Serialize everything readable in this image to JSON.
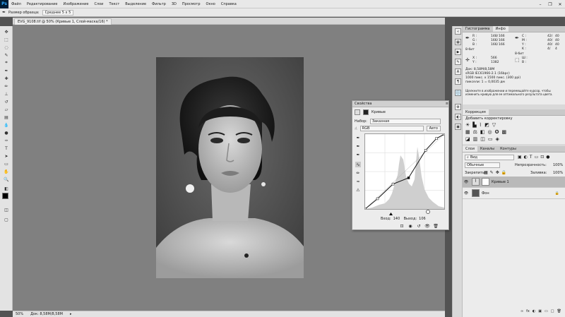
{
  "app": {
    "logo": "Ps"
  },
  "menu": [
    "Файл",
    "Редактирование",
    "Изображение",
    "Слои",
    "Текст",
    "Выделение",
    "Фильтр",
    "3D",
    "Просмотр",
    "Окно",
    "Справка"
  ],
  "window_controls": {
    "minimize": "–",
    "restore": "❐",
    "close": "✕"
  },
  "options_bar": {
    "label": "Размер образца:",
    "value": "Среднее 5 х 5"
  },
  "document": {
    "tab_title": "EVG_9108.tif @ 50% (Кривые 1, Слой-маска/16) *",
    "zoom": "50%",
    "doc_info": "Док: 8,58M/8,58M"
  },
  "info_panel": {
    "tabs": [
      "Гистограмма",
      "Инфо"
    ],
    "c1": {
      "r": "R :",
      "g": "G :",
      "b": "B :",
      "r_val": "148/",
      "g_val": "166/",
      "b_val": "166/",
      "r_val2": "166",
      "g_val2": "166",
      "b_val2": "166"
    },
    "c2": {
      "c": "C :",
      "m": "M :",
      "y": "Y :",
      "k": "K :",
      "c_val": "42/",
      "m_val": "40/",
      "y_val": "40/",
      "k_val": "4/",
      "c_val2": "40",
      "m_val2": "40",
      "y_val2": "40",
      "k_val2": "4"
    },
    "bit1": "8-бит",
    "bit2": "8-бит",
    "xy": {
      "x": "X :",
      "y": "Y :",
      "x_val": "566",
      "y_val": "1382"
    },
    "wh": {
      "w": "Ш :",
      "h": "В :"
    },
    "doc_lines": [
      "Док: 8,58M/8,58M",
      "sRGB IEC61966-2.1 (16bpc)",
      "1000 пикс. x 1500 пикс. (300 ppi)",
      "пиксели: 1 = 0,0035 дм"
    ],
    "hint": "Щелкните в изображении и перемещайте курсор, чтобы изменить кривую для ее оптимального результата цвета."
  },
  "corrections_panel": {
    "tab": "Коррекция",
    "title": "Добавить корректировку"
  },
  "layers_panel": {
    "tabs": [
      "Слои",
      "Каналы",
      "Контуры"
    ],
    "search": "Вид",
    "blend_mode": "Обычные",
    "opacity_label": "Непрозрачность:",
    "opacity_value": "100%",
    "lock_label": "Закрепить:",
    "fill_label": "Заливка:",
    "fill_value": "100%",
    "layers": [
      {
        "name": "Кривые 1",
        "active": true
      },
      {
        "name": "Фон",
        "active": false
      }
    ],
    "bottom_icons": [
      "∞",
      "fx",
      "◐",
      "▣",
      "▭",
      "□",
      "🗑"
    ]
  },
  "properties_panel": {
    "title": "Свойства",
    "kind": "Кривые",
    "preset_label": "Набор:",
    "preset_value": "Заказная",
    "channel": "RGB",
    "auto": "Авто",
    "input_label": "Вход:",
    "input_value": "140",
    "output_label": "Выход:",
    "output_value": "106"
  },
  "colors": {
    "accent": "#31a8ff",
    "canvas": "#808080",
    "panel": "#d9d9d9"
  },
  "chart_data": {
    "type": "line",
    "title": "",
    "xlim": [
      0,
      255
    ],
    "ylim": [
      0,
      255
    ],
    "series": [
      {
        "name": "",
        "x": [
          0,
          40,
          90,
          140,
          195,
          230,
          255
        ],
        "y": [
          0,
          35,
          85,
          106,
          200,
          240,
          255
        ]
      }
    ],
    "points": [
      {
        "x": 0,
        "y": 0
      },
      {
        "x": 40,
        "y": 35
      },
      {
        "x": 90,
        "y": 85
      },
      {
        "x": 140,
        "y": 106
      },
      {
        "x": 195,
        "y": 200
      },
      {
        "x": 230,
        "y": 240
      },
      {
        "x": 255,
        "y": 255
      }
    ]
  }
}
